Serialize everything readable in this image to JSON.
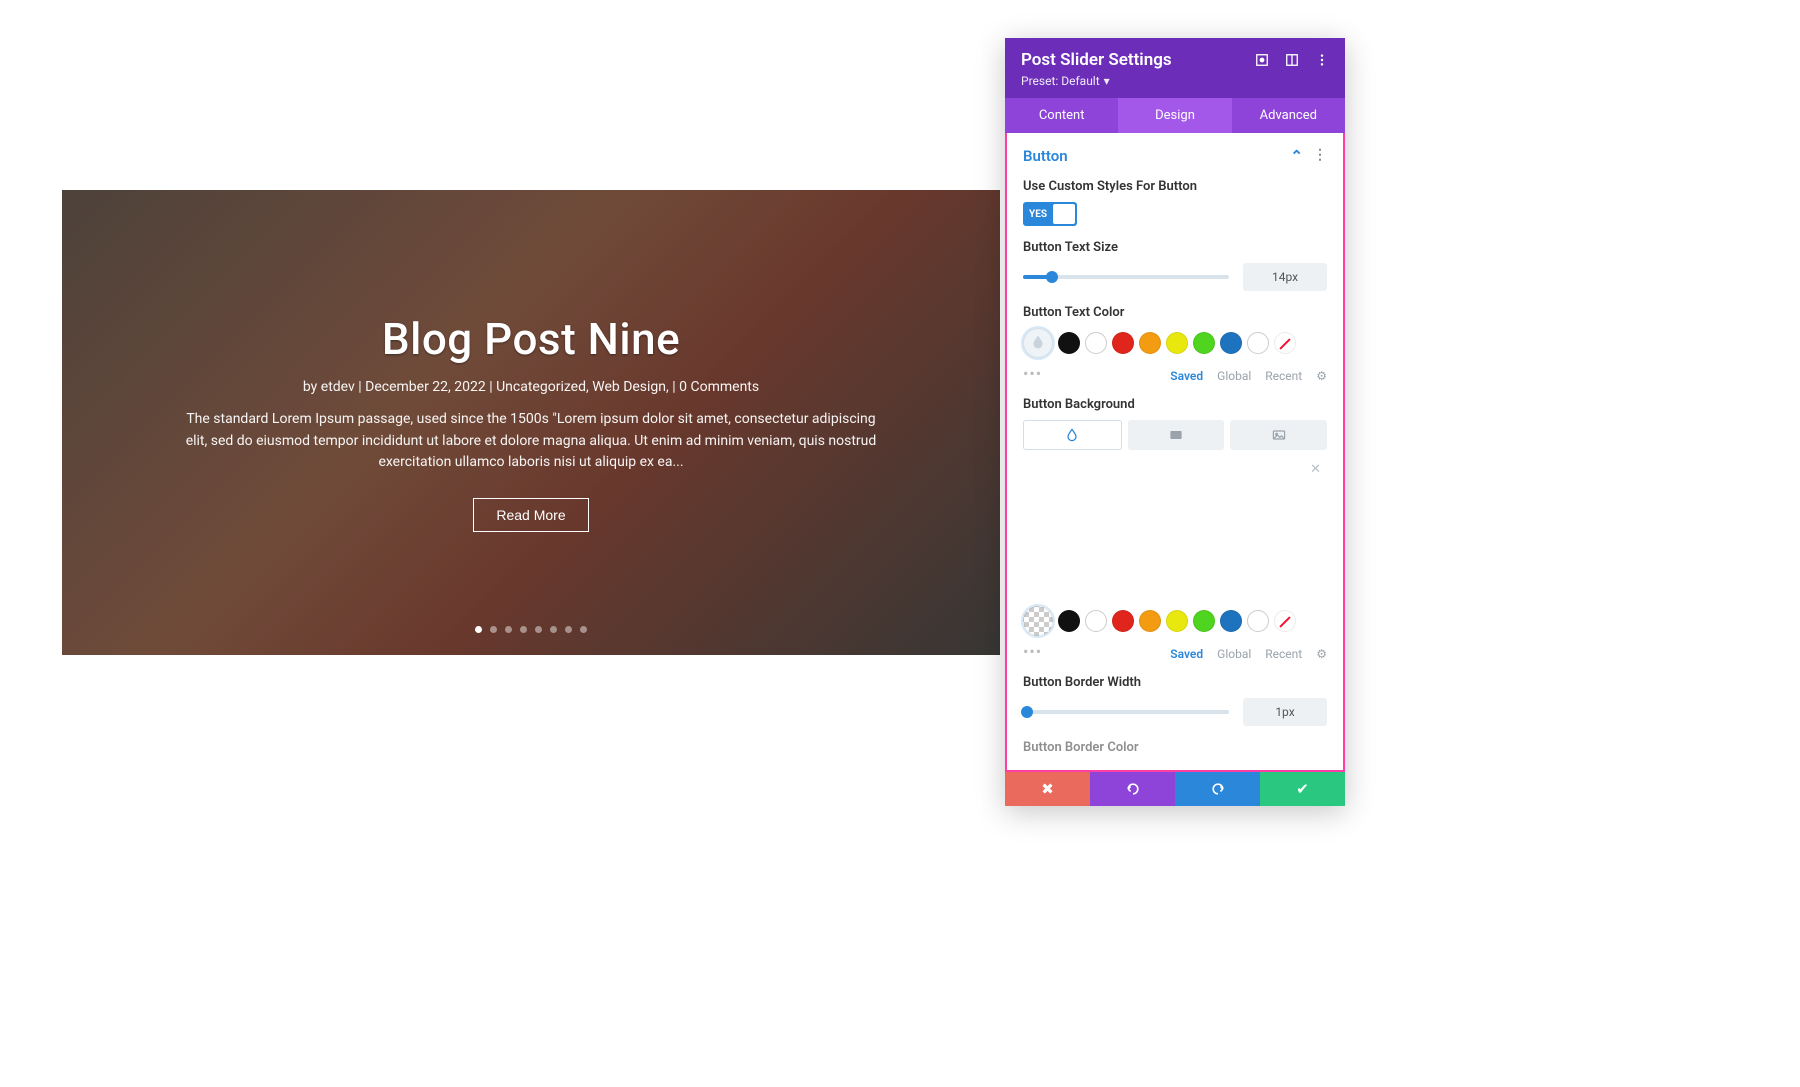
{
  "slider": {
    "title": "Blog Post Nine",
    "meta": "by etdev | December 22, 2022 | Uncategorized, Web Design, | 0 Comments",
    "excerpt": "The standard Lorem Ipsum passage, used since the 1500s \"Lorem ipsum dolor sit amet, consectetur adipiscing elit, sed do eiusmod tempor incididunt ut labore et dolore magna aliqua. Ut enim ad minim veniam, quis nostrud exercitation ullamco laboris nisi ut aliquip ex ea...",
    "read_more": "Read More",
    "dot_count": 8,
    "active_dot": 0
  },
  "panel": {
    "title": "Post Slider Settings",
    "preset_label": "Preset: Default",
    "tabs": [
      "Content",
      "Design",
      "Advanced"
    ],
    "active_tab": 1,
    "section": {
      "title": "Button",
      "custom_styles_label": "Use Custom Styles For Button",
      "custom_styles_value": "YES",
      "text_size_label": "Button Text Size",
      "text_size_value": "14px",
      "text_size_pct": 14,
      "text_color_label": "Button Text Color",
      "bg_label": "Button Background",
      "border_width_label": "Button Border Width",
      "border_width_value": "1px",
      "border_width_pct": 2,
      "border_color_label": "Button Border Color"
    },
    "palette": {
      "colors": [
        "#111111",
        "#ffffff",
        "#e0261c",
        "#f39c12",
        "#e8e80e",
        "#4fd41f",
        "#1e73be",
        "#ffffff"
      ],
      "tabs": [
        "Saved",
        "Global",
        "Recent"
      ],
      "active": 0
    },
    "footer_icons": [
      "cancel",
      "undo",
      "redo",
      "save"
    ]
  }
}
